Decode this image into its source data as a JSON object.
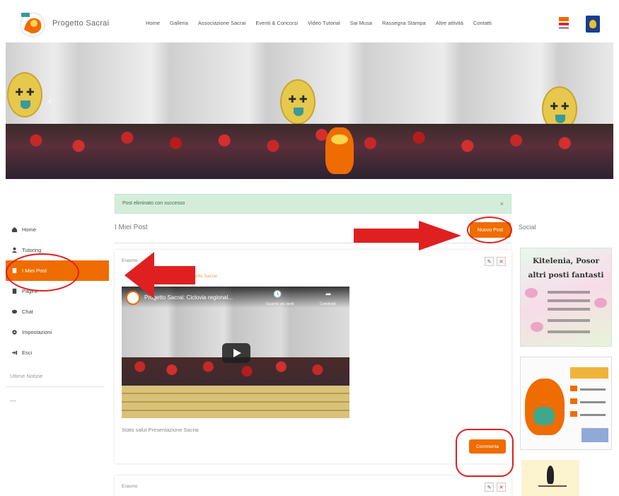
{
  "header": {
    "brand": "Progetto Sacrai",
    "nav": [
      "Home",
      "Galleria",
      "Associazione Sacrai",
      "Eventi & Concorsi",
      "Video Tutorial",
      "Sai Musa",
      "Rassegna Stampa",
      "Altre attività",
      "Contatti"
    ]
  },
  "sidebar": {
    "items": [
      {
        "label": "Home",
        "icon": "home-icon"
      },
      {
        "label": "Tutoring",
        "icon": "tutoring-icon"
      },
      {
        "label": "I Miei Post",
        "icon": "post-icon"
      },
      {
        "label": "Pagine",
        "icon": "pages-icon"
      },
      {
        "label": "Chat",
        "icon": "chat-icon"
      },
      {
        "label": "Impostazioni",
        "icon": "settings-icon"
      },
      {
        "label": "Esci",
        "icon": "logout-icon"
      }
    ],
    "section": "Ultime Notizie",
    "dash": "—"
  },
  "main": {
    "alert": "Post eliminato con successo",
    "title": "I Miei Post",
    "new_post": "Nuovo Post",
    "post": {
      "author": "Erasmo",
      "subtitle": "Progetto Sacrai",
      "video_title": "Progetto Sacrai: Ciclovia regional...",
      "watch_later": "Guarda più tardi",
      "share": "Condividi",
      "caption": "Stato salut Presentazione Sacrai",
      "comment": "Commenta"
    },
    "post2_author": "Erasmo"
  },
  "right": {
    "title": "Social",
    "ad1_line1": "Kitelenia, Posor",
    "ad1_line2": "altri posti fantasti"
  },
  "colors": {
    "accent": "#ef6c00",
    "alert_bg": "#d4edda",
    "annotation": "#e02020"
  }
}
